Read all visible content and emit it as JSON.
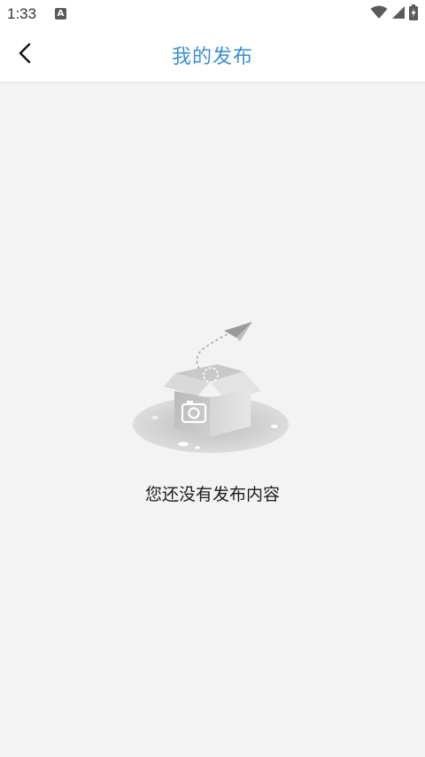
{
  "status_bar": {
    "time": "1:33",
    "notification_badge": "A",
    "icons": [
      "wifi-icon",
      "signal-icon",
      "battery-charging-icon"
    ]
  },
  "header": {
    "title": "我的发布",
    "back_icon": "back-arrow-icon",
    "title_color": "#3e8fcf"
  },
  "empty_state": {
    "illustration": "empty-box-camera-paper-plane",
    "message": "您还没有发布内容"
  }
}
